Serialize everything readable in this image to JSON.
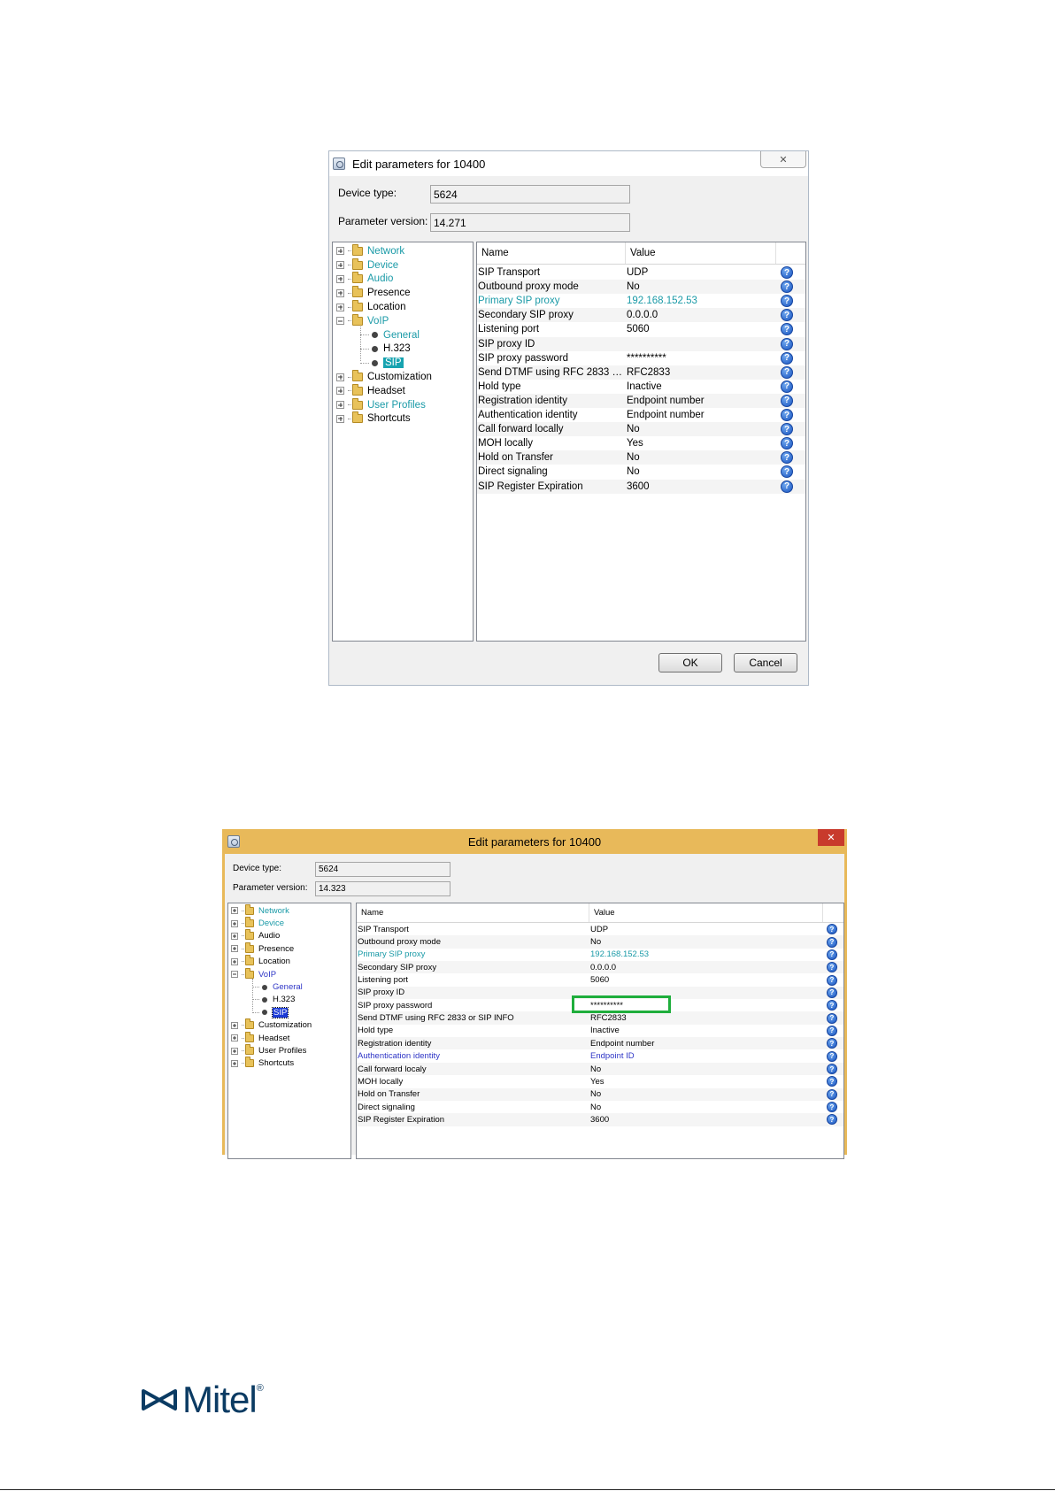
{
  "dialog1": {
    "title": "Edit parameters for 10400",
    "close_glyph": "✕",
    "device_type_label": "Device type:",
    "device_type_value": "5624",
    "param_version_label": "Parameter version:",
    "param_version_value": "14.271",
    "columns": {
      "name": "Name",
      "value": "Value"
    },
    "tree": [
      {
        "label": "Network",
        "style": "teal"
      },
      {
        "label": "Device",
        "style": "teal"
      },
      {
        "label": "Audio",
        "style": "teal"
      },
      {
        "label": "Presence",
        "style": ""
      },
      {
        "label": "Location",
        "style": ""
      },
      {
        "label": "VoIP",
        "style": "teal"
      },
      {
        "label": "General",
        "style": "teal"
      },
      {
        "label": "H.323",
        "style": ""
      },
      {
        "label": "SIP",
        "style": "sel"
      },
      {
        "label": "Customization",
        "style": ""
      },
      {
        "label": "Headset",
        "style": ""
      },
      {
        "label": "User Profiles",
        "style": "teal"
      },
      {
        "label": "Shortcuts",
        "style": ""
      }
    ],
    "rows": [
      {
        "name": "SIP Transport",
        "value": "UDP"
      },
      {
        "name": "Outbound proxy mode",
        "value": "No"
      },
      {
        "name": "Primary SIP proxy",
        "value": "192.168.152.53",
        "style": "teal"
      },
      {
        "name": "Secondary SIP proxy",
        "value": "0.0.0.0"
      },
      {
        "name": "Listening port",
        "value": "5060"
      },
      {
        "name": "SIP proxy ID",
        "value": ""
      },
      {
        "name": "SIP proxy password",
        "value": "**********"
      },
      {
        "name": "Send DTMF using RFC 2833 or…",
        "value": "RFC2833"
      },
      {
        "name": "Hold type",
        "value": "Inactive"
      },
      {
        "name": "Registration identity",
        "value": "Endpoint number"
      },
      {
        "name": "Authentication identity",
        "value": "Endpoint number"
      },
      {
        "name": "Call forward locally",
        "value": "No"
      },
      {
        "name": "MOH locally",
        "value": "Yes"
      },
      {
        "name": "Hold on Transfer",
        "value": "No"
      },
      {
        "name": "Direct signaling",
        "value": "No"
      },
      {
        "name": "SIP Register Expiration",
        "value": "3600"
      }
    ],
    "help_glyph": "?",
    "ok_label": "OK",
    "cancel_label": "Cancel"
  },
  "dialog2": {
    "title": "Edit parameters for 10400",
    "close_glyph": "✕",
    "device_type_label": "Device type:",
    "device_type_value": "5624",
    "param_version_label": "Parameter version:",
    "param_version_value": "14.323",
    "columns": {
      "name": "Name",
      "value": "Value"
    },
    "tree": [
      {
        "label": "Network",
        "style": "teal"
      },
      {
        "label": "Device",
        "style": "teal"
      },
      {
        "label": "Audio",
        "style": ""
      },
      {
        "label": "Presence",
        "style": ""
      },
      {
        "label": "Location",
        "style": ""
      },
      {
        "label": "VoIP",
        "style": "navy"
      },
      {
        "label": "General",
        "style": "navy"
      },
      {
        "label": "H.323",
        "style": ""
      },
      {
        "label": "SIP",
        "style": "sel2"
      },
      {
        "label": "Customization",
        "style": ""
      },
      {
        "label": "Headset",
        "style": ""
      },
      {
        "label": "User Profiles",
        "style": ""
      },
      {
        "label": "Shortcuts",
        "style": ""
      }
    ],
    "rows": [
      {
        "name": "SIP Transport",
        "value": "UDP"
      },
      {
        "name": "Outbound proxy mode",
        "value": "No"
      },
      {
        "name": "Primary SIP proxy",
        "value": "192.168.152.53",
        "style": "teal"
      },
      {
        "name": "Secondary SIP proxy",
        "value": "0.0.0.0"
      },
      {
        "name": "Listening port",
        "value": "5060"
      },
      {
        "name": "SIP proxy ID",
        "value": ""
      },
      {
        "name": "SIP proxy password",
        "value": "**********"
      },
      {
        "name": "Send DTMF using RFC 2833 or SIP INFO",
        "value": "RFC2833"
      },
      {
        "name": "Hold type",
        "value": "Inactive"
      },
      {
        "name": "Registration identity",
        "value": "Endpoint number"
      },
      {
        "name": "Authentication identity",
        "value": "Endpoint ID",
        "style": "navy"
      },
      {
        "name": "Call forward localy",
        "value": "No"
      },
      {
        "name": "MOH locally",
        "value": "Yes"
      },
      {
        "name": "Hold on Transfer",
        "value": "No"
      },
      {
        "name": "Direct signaling",
        "value": "No"
      },
      {
        "name": "SIP Register Expiration",
        "value": "3600"
      }
    ],
    "help_glyph": "?",
    "highlight_color": "#1fae3c"
  },
  "logo": {
    "text": "Mitel",
    "registered": "®",
    "color": "#0b3b63"
  }
}
